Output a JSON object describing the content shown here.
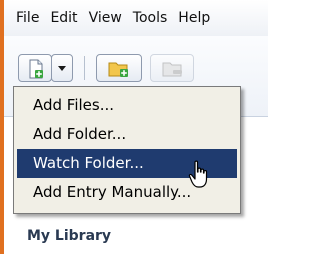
{
  "menubar": {
    "items": [
      "File",
      "Edit",
      "View",
      "Tools",
      "Help"
    ]
  },
  "toolbar": {
    "buttons": [
      {
        "name": "add-files",
        "icon": "new-file-plus-icon"
      },
      {
        "name": "add-dropdown",
        "icon": "chevron-down-icon"
      },
      {
        "name": "add-folder",
        "icon": "folder-plus-icon"
      },
      {
        "name": "remove",
        "icon": "remove-icon",
        "disabled": true
      }
    ]
  },
  "dropdown": {
    "items": [
      {
        "label": "Add Files..."
      },
      {
        "label": "Add Folder..."
      },
      {
        "label": "Watch Folder...",
        "active": true
      },
      {
        "label": "Add Entry Manually..."
      }
    ]
  },
  "sidebar": {
    "library_label": "My Library"
  },
  "colors": {
    "accent_orange": "#e07020",
    "menu_highlight": "#1f3b6f",
    "menu_background": "#f1efe6"
  }
}
